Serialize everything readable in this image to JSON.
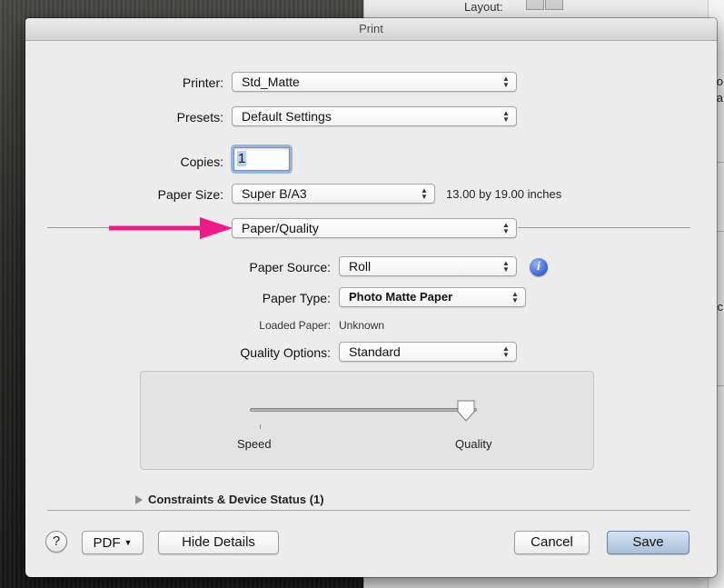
{
  "background": {
    "layout_label": "Layout:",
    "right_text_1": "o",
    "right_text_2": "ia",
    "right_text_3": "c"
  },
  "dialog": {
    "title": "Print",
    "printer": {
      "label": "Printer:",
      "value": "Std_Matte"
    },
    "presets": {
      "label": "Presets:",
      "value": "Default Settings"
    },
    "copies": {
      "label": "Copies:",
      "value": "1"
    },
    "paper_size": {
      "label": "Paper Size:",
      "value": "Super B/A3",
      "dimensions": "13.00 by 19.00 inches"
    },
    "section_popup": {
      "value": "Paper/Quality"
    },
    "paper_source": {
      "label": "Paper Source:",
      "value": "Roll"
    },
    "paper_type": {
      "label": "Paper Type:",
      "value": "Photo Matte Paper"
    },
    "loaded_paper": {
      "label": "Loaded Paper:",
      "value": "Unknown"
    },
    "quality_options": {
      "label": "Quality Options:",
      "value": "Standard"
    },
    "slider": {
      "left_label": "Speed",
      "right_label": "Quality",
      "position": 0.95
    },
    "disclosure": {
      "label": "Constraints & Device Status (1)"
    },
    "footer": {
      "help_label": "?",
      "pdf_label": "PDF",
      "hide_details_label": "Hide Details",
      "cancel_label": "Cancel",
      "save_label": "Save"
    }
  },
  "colors": {
    "annotation_arrow": "#ee1b86",
    "info_icon": "#3b62d6",
    "default_button": "#a9bfd9"
  }
}
